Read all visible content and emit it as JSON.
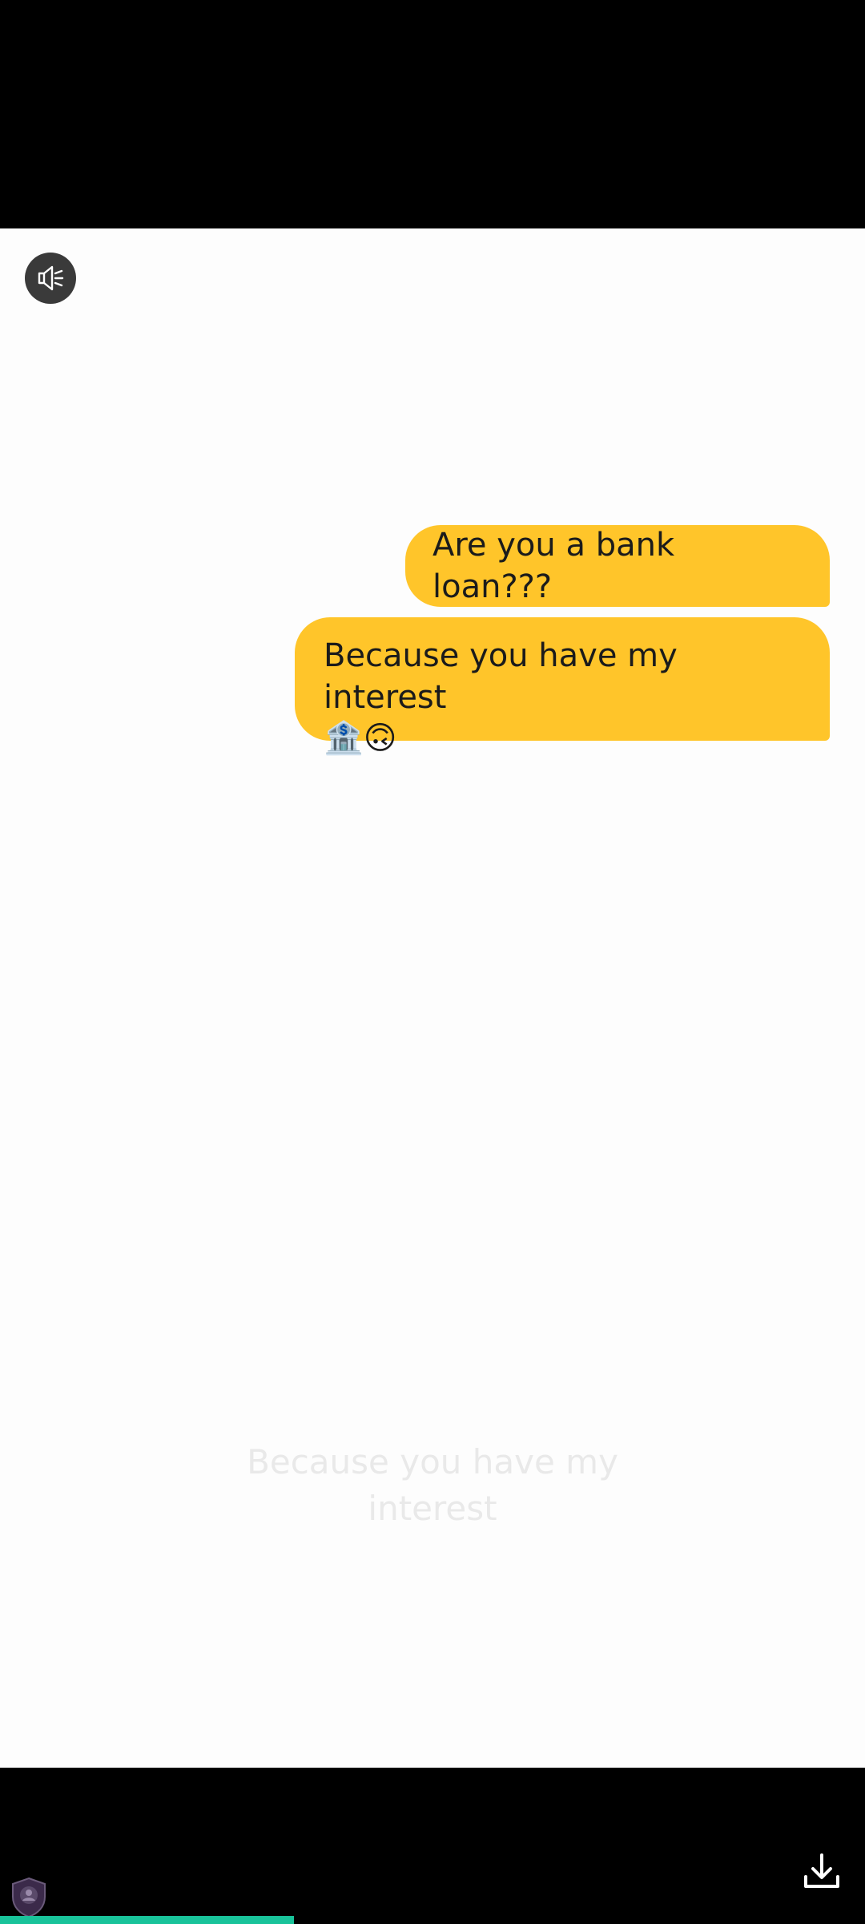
{
  "messages": [
    {
      "text": "Are you a bank loan???"
    },
    {
      "text": "Because you have my interest",
      "emojis": "🏦🙃"
    }
  ],
  "caption": "Because you have my interest",
  "controls": {
    "mute_icon": "speaker-muted-icon",
    "download_icon": "download-icon",
    "shield_icon": "privacy-shield-icon"
  },
  "progress": {
    "fraction": 0.34,
    "color": "#19c39a"
  },
  "colors": {
    "bubble": "#ffc52a",
    "video_background": "#fdfdfd"
  }
}
